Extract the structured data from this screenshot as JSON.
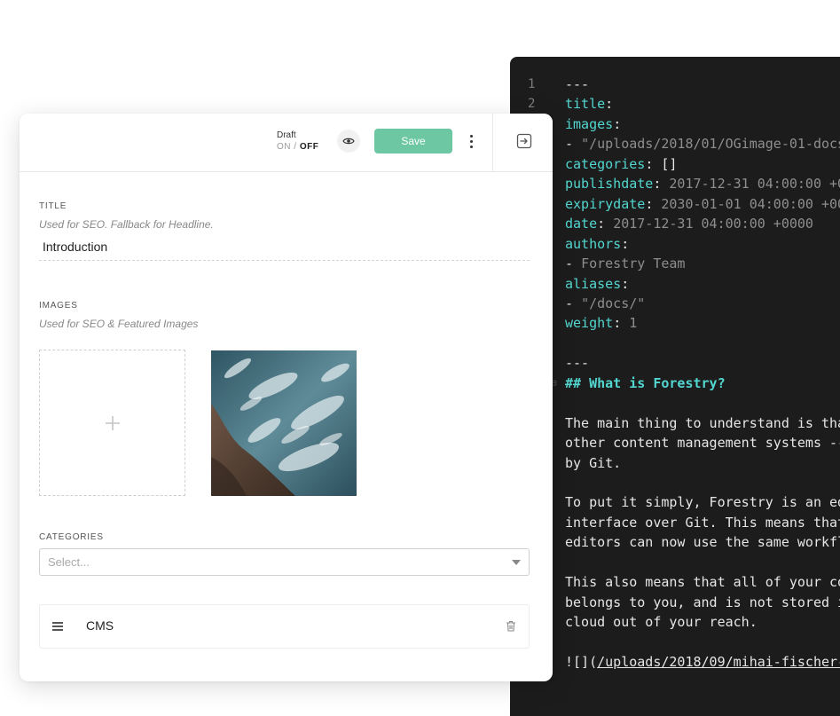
{
  "editor": {
    "lines": [
      {
        "n": "1",
        "segs": [
          {
            "t": "---",
            "c": "p"
          }
        ]
      },
      {
        "n": "2",
        "segs": [
          {
            "t": "title",
            "c": "k"
          },
          {
            "t": ":",
            "c": "p"
          }
        ]
      },
      {
        "n": "",
        "segs": [
          {
            "t": "images",
            "c": "k"
          },
          {
            "t": ":",
            "c": "p"
          }
        ]
      },
      {
        "n": "",
        "segs": [
          {
            "t": "- ",
            "c": "p"
          },
          {
            "t": "\"/uploads/2018/01/OGimage-01-docs",
            "c": "v"
          }
        ]
      },
      {
        "n": "",
        "segs": [
          {
            "t": "categories",
            "c": "k"
          },
          {
            "t": ": []",
            "c": "p"
          }
        ]
      },
      {
        "n": "",
        "segs": [
          {
            "t": "publishdate",
            "c": "k"
          },
          {
            "t": ": ",
            "c": "p"
          },
          {
            "t": "2017-12-31 04:00:00 +0",
            "c": "v"
          }
        ]
      },
      {
        "n": "",
        "segs": [
          {
            "t": "expirydate",
            "c": "k"
          },
          {
            "t": ": ",
            "c": "p"
          },
          {
            "t": "2030-01-01 04:00:00 +00",
            "c": "v"
          }
        ]
      },
      {
        "n": "",
        "segs": [
          {
            "t": "date",
            "c": "k"
          },
          {
            "t": ": ",
            "c": "p"
          },
          {
            "t": "2017-12-31 04:00:00 +0000",
            "c": "v"
          }
        ]
      },
      {
        "n": "",
        "segs": [
          {
            "t": "authors",
            "c": "k"
          },
          {
            "t": ":",
            "c": "p"
          }
        ]
      },
      {
        "n": "",
        "segs": [
          {
            "t": "- ",
            "c": "p"
          },
          {
            "t": "Forestry Team",
            "c": "v"
          }
        ]
      },
      {
        "n": "",
        "segs": [
          {
            "t": "aliases",
            "c": "k"
          },
          {
            "t": ":",
            "c": "p"
          }
        ]
      },
      {
        "n": "",
        "segs": [
          {
            "t": "- ",
            "c": "p"
          },
          {
            "t": "\"/docs/\"",
            "c": "v"
          }
        ]
      },
      {
        "n": "",
        "segs": [
          {
            "t": "weight",
            "c": "k"
          },
          {
            "t": ": ",
            "c": "p"
          },
          {
            "t": "1",
            "c": "v"
          }
        ]
      },
      {
        "n": "",
        "segs": []
      },
      {
        "n": "",
        "segs": [
          {
            "t": "---",
            "c": "p"
          }
        ]
      },
      {
        "n": "",
        "segs": [
          {
            "t": "## What is Forestry?",
            "c": "h"
          }
        ],
        "fold": true
      },
      {
        "n": "",
        "segs": []
      },
      {
        "n": "",
        "segs": [
          {
            "t": "The main thing to understand is tha",
            "c": "p"
          }
        ]
      },
      {
        "n": "",
        "segs": [
          {
            "t": "other content management systems --",
            "c": "p"
          }
        ]
      },
      {
        "n": "",
        "segs": [
          {
            "t": "by Git.",
            "c": "p"
          }
        ]
      },
      {
        "n": "",
        "segs": []
      },
      {
        "n": "",
        "segs": [
          {
            "t": "To put it simply, Forestry is an ed",
            "c": "p"
          }
        ]
      },
      {
        "n": "",
        "segs": [
          {
            "t": "interface over Git. This means that",
            "c": "p"
          }
        ]
      },
      {
        "n": "",
        "segs": [
          {
            "t": "editors can now use the same workfl",
            "c": "p"
          }
        ]
      },
      {
        "n": "",
        "segs": []
      },
      {
        "n": "",
        "segs": [
          {
            "t": "This also means that all of your co",
            "c": "p"
          }
        ]
      },
      {
        "n": "",
        "segs": [
          {
            "t": "belongs to you, and is not stored i",
            "c": "p"
          }
        ]
      },
      {
        "n": "",
        "segs": [
          {
            "t": "cloud out of your reach.",
            "c": "p"
          }
        ]
      },
      {
        "n": "",
        "segs": []
      },
      {
        "n": "",
        "segs": [
          {
            "t": "![](",
            "c": "p"
          },
          {
            "t": "/uploads/2018/09/mihai-fischer-",
            "c": "u"
          }
        ]
      }
    ]
  },
  "topbar": {
    "draft_label": "Draft",
    "on": "ON",
    "sep": " / ",
    "off": "OFF",
    "save_label": "Save"
  },
  "fields": {
    "title": {
      "label": "TITLE",
      "help": "Used for SEO. Fallback for Headline.",
      "value": "Introduction"
    },
    "images": {
      "label": "IMAGES",
      "help": "Used for SEO & Featured Images"
    },
    "categories": {
      "label": "CATEGORIES",
      "placeholder": "Select...",
      "items": [
        "CMS"
      ]
    }
  },
  "colors": {
    "accent": "#6cc7a2",
    "editor_bg": "#1c1c1c",
    "yaml_key": "#53d6cf"
  },
  "icons": {
    "preview": "eye-icon",
    "more": "kebab-menu-icon",
    "exit": "sign-out-icon",
    "add_image": "plus-icon",
    "drag": "drag-handle-icon",
    "delete": "trash-icon"
  }
}
